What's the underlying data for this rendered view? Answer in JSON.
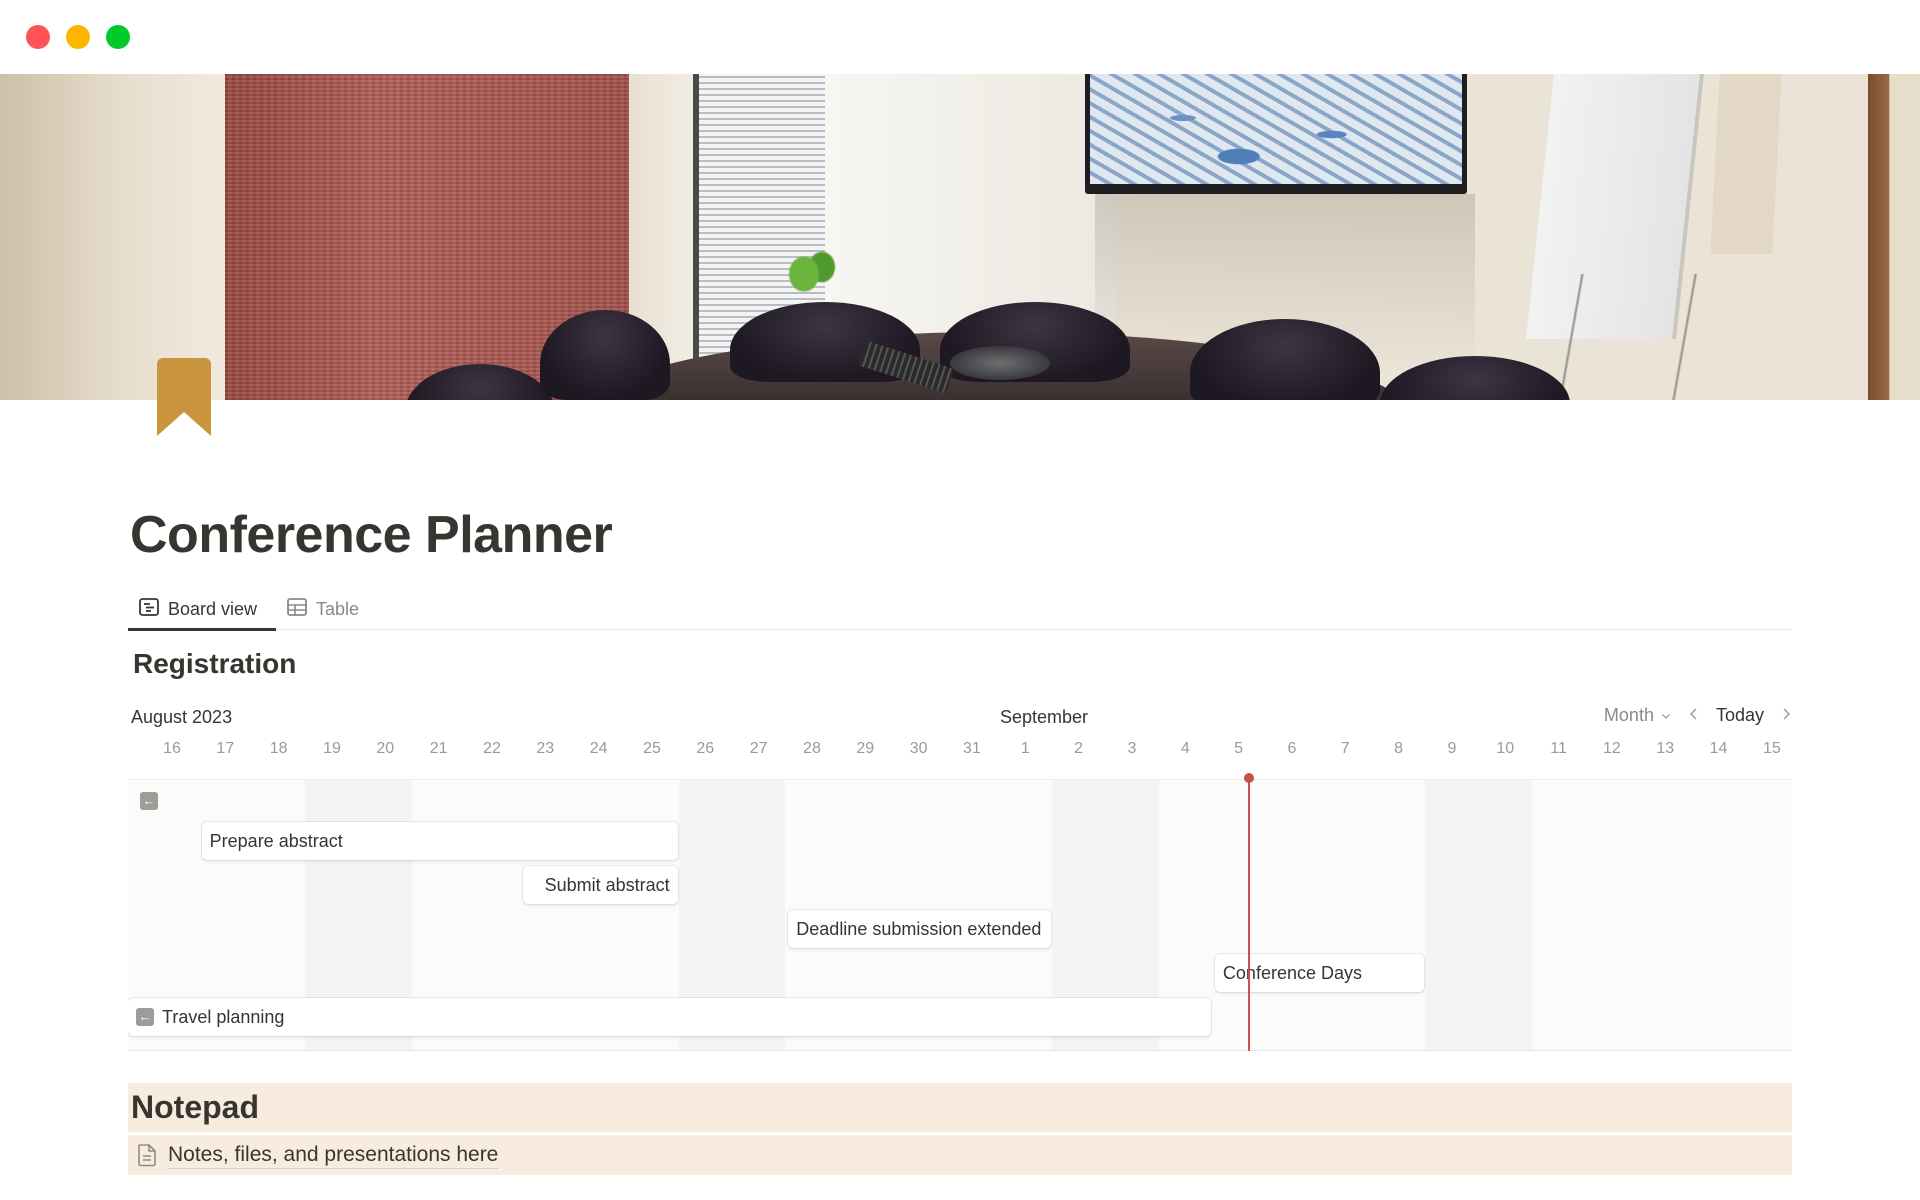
{
  "window": {
    "controls": [
      "close",
      "minimize",
      "maximize"
    ],
    "colors": {
      "close": "#ff5257",
      "minimize": "#ffb400",
      "maximize": "#00c92a"
    }
  },
  "page": {
    "icon": "bookmark-icon",
    "icon_color": "#c9963f",
    "title": "Conference Planner",
    "cover": "meeting-room-photo"
  },
  "tabs": [
    {
      "label": "Board view",
      "icon": "board-icon",
      "active": true
    },
    {
      "label": "Table",
      "icon": "table-icon",
      "active": false
    }
  ],
  "timeline": {
    "title": "Registration",
    "months": {
      "first": "August 2023",
      "second": "September"
    },
    "controls": {
      "scale": "Month",
      "today": "Today",
      "prev": "‹",
      "next": "›"
    },
    "days": [
      "16",
      "17",
      "18",
      "19",
      "20",
      "21",
      "22",
      "23",
      "24",
      "25",
      "26",
      "27",
      "28",
      "29",
      "30",
      "31",
      "1",
      "2",
      "3",
      "4",
      "5",
      "6",
      "7",
      "8",
      "9",
      "10",
      "11",
      "12",
      "13",
      "14",
      "15"
    ],
    "weekend_indices": [
      3,
      4,
      10,
      11,
      17,
      18,
      24,
      25
    ],
    "today_index": 20.2,
    "today_color": "#c9514b",
    "events": [
      {
        "label": "Prepare abstract",
        "start": 1,
        "end": 9,
        "row": 1,
        "align": "left"
      },
      {
        "label": "Submit abstract",
        "start": 9,
        "end": 9,
        "row": 2,
        "align": "right"
      },
      {
        "label": "Deadline submission extended",
        "start": 12,
        "end": 16,
        "row": 3,
        "align": "left"
      },
      {
        "label": "Conference Days",
        "start": 20,
        "end": 23,
        "row": 4,
        "align": "left"
      },
      {
        "label": "Travel planning",
        "start": -1,
        "end": 19,
        "row": 5,
        "align": "left",
        "continues_before": true
      }
    ]
  },
  "notepad": {
    "title": "Notepad",
    "items": [
      {
        "label": "Notes, files, and presentations here",
        "icon": "document-icon"
      }
    ],
    "background": "#f8ecdf"
  }
}
